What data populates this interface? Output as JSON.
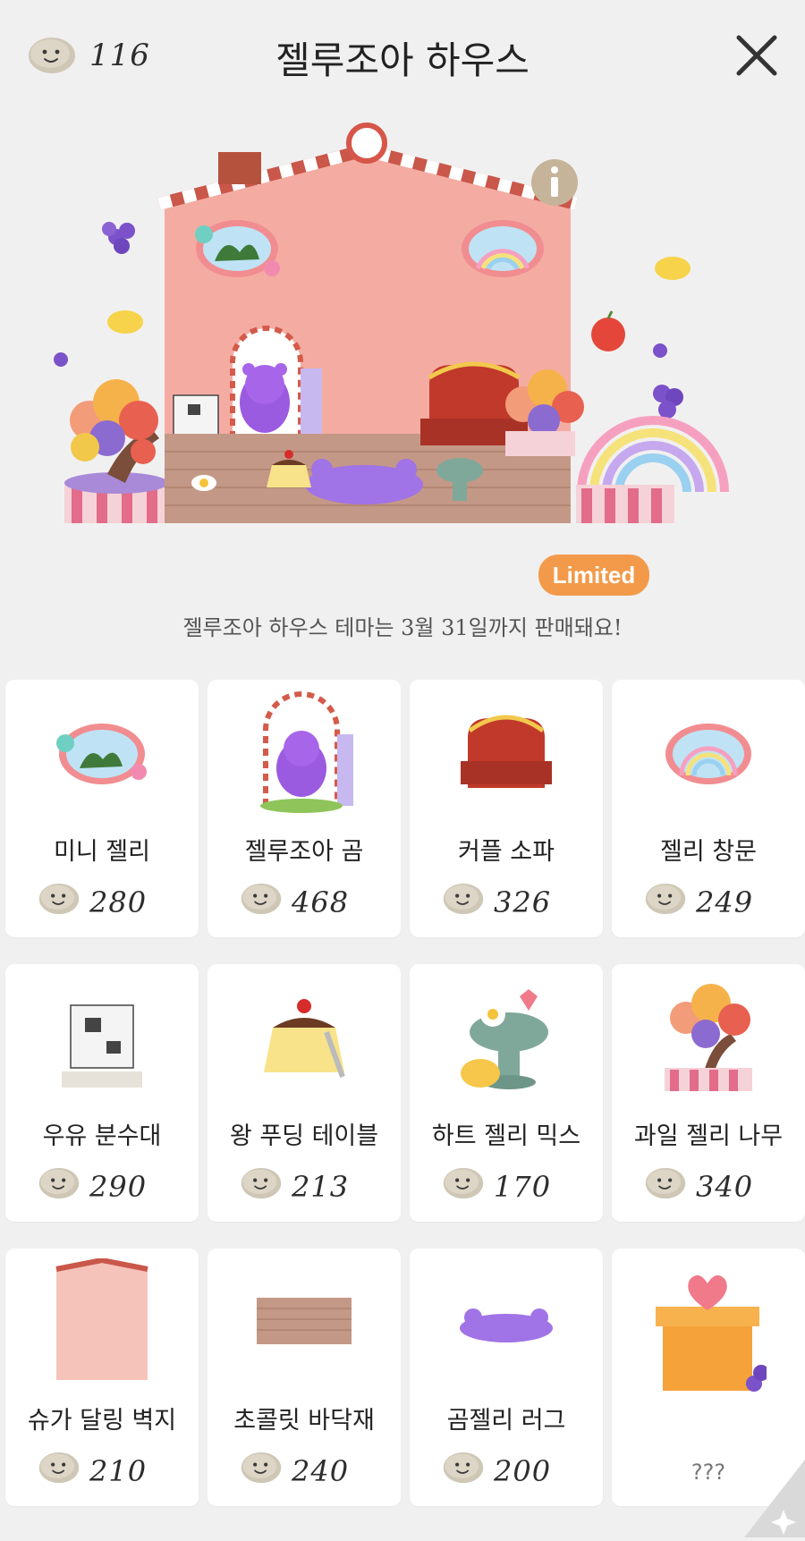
{
  "header": {
    "coin_count": "116",
    "title": "젤루조아 하우스",
    "close_icon": "close-icon",
    "coin_icon": "jelly-coin-icon"
  },
  "scene": {
    "badge": "Limited",
    "notice": "젤루조아 하우스 테마는 3월 31일까지 판매돼요!",
    "info_icon": "info-icon"
  },
  "colors": {
    "background": "#f1f0f0",
    "wall": "#f4aca2",
    "badge": "#f39a4a",
    "roof_stripe": "#c9574a"
  },
  "items": [
    {
      "name": "미니 젤리",
      "price": "280",
      "icon": "mini-jelly-window-icon"
    },
    {
      "name": "젤루조아 곰",
      "price": "468",
      "icon": "jelly-bear-door-icon"
    },
    {
      "name": "커플 소파",
      "price": "326",
      "icon": "couple-sofa-icon"
    },
    {
      "name": "젤리 창문",
      "price": "249",
      "icon": "jelly-window-icon"
    },
    {
      "name": "우유 분수대",
      "price": "290",
      "icon": "milk-fountain-icon"
    },
    {
      "name": "왕 푸딩 테이블",
      "price": "213",
      "icon": "pudding-table-icon"
    },
    {
      "name": "하트 젤리 믹스",
      "price": "170",
      "icon": "heart-jelly-mix-icon"
    },
    {
      "name": "과일 젤리 나무",
      "price": "340",
      "icon": "fruit-jelly-tree-icon"
    },
    {
      "name": "슈가 달링 벽지",
      "price": "210",
      "icon": "sugar-darling-wallpaper-icon"
    },
    {
      "name": "초콜릿 바닥재",
      "price": "240",
      "icon": "chocolate-floor-icon"
    },
    {
      "name": "곰젤리 러그",
      "price": "200",
      "icon": "bear-jelly-rug-icon"
    },
    {
      "name": "",
      "price": "???",
      "icon": "mystery-gift-box-icon"
    }
  ]
}
